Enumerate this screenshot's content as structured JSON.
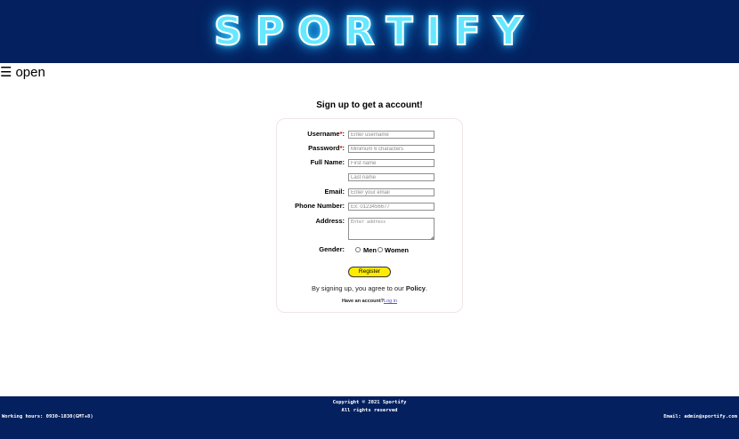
{
  "header": {
    "logo_text": "SPORTIFY"
  },
  "nav": {
    "menu_icon": "☰",
    "toggle_label": "open"
  },
  "form": {
    "title": "Sign up to get a account!",
    "username": {
      "label": "Username",
      "required_mark": "*",
      "colon": ":",
      "placeholder": "Enter username"
    },
    "password": {
      "label": "Password",
      "required_mark": "*",
      "colon": ":",
      "placeholder": "Minimum 6 characters"
    },
    "full_name": {
      "label": "Full Name:",
      "first_placeholder": "First name",
      "last_placeholder": "Last name"
    },
    "email": {
      "label": "Email:",
      "placeholder": "Enter your email"
    },
    "phone": {
      "label": "Phone Number:",
      "placeholder": "Ex: 0123456677"
    },
    "address": {
      "label": "Address:",
      "placeholder": "Enter address"
    },
    "gender": {
      "label": "Gender:",
      "options": [
        "Men",
        "Women"
      ]
    },
    "register_label": "Register",
    "policy_prefix": "By signing up, you agree to our ",
    "policy_link": "Policy",
    "policy_suffix": ".",
    "login_prompt": "Have an account?",
    "login_link": "Log in"
  },
  "footer": {
    "copyright": "Copyright © 2021 Sportify",
    "rights": "All rights reserved",
    "hours": "Working hours: 0930-1830(GMT+8)",
    "email": "Email: admin@sportify.com"
  },
  "colors": {
    "header_bg": "#04205e",
    "logo": "#66e8ff",
    "register_button": "#ffec00",
    "required": "#dd0000",
    "link": "#5a4fcf"
  }
}
